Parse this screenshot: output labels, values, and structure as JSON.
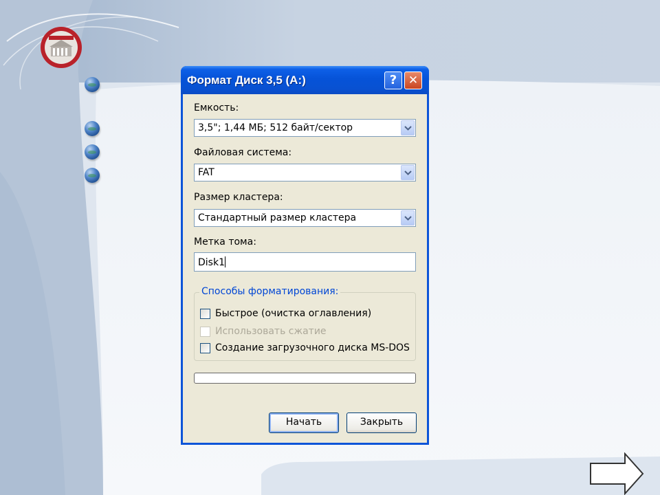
{
  "dialog": {
    "title": "Формат Диск 3,5 (A:)",
    "help_glyph": "?",
    "close_glyph": "✕",
    "capacity": {
      "label": "Емкость:",
      "value": "3,5\";  1,44 МБ; 512 байт/сектор"
    },
    "filesystem": {
      "label": "Файловая система:",
      "value": "FAT"
    },
    "cluster": {
      "label": "Размер кластера:",
      "value": "Стандартный размер кластера"
    },
    "volume": {
      "label": "Метка тома:",
      "value": "Disk1"
    },
    "format_options": {
      "title": "Способы форматирования:",
      "quick": {
        "label": "Быстрое (очистка оглавления)",
        "checked": false
      },
      "compression": {
        "label": "Использовать сжатие",
        "checked": false,
        "enabled": false
      },
      "boot_disk": {
        "label": "Создание загрузочного диска MS-DOS",
        "checked": false
      }
    },
    "progress": 0,
    "start_button": "Начать",
    "close_button": "Закрыть"
  },
  "slide": {
    "bullets": 4,
    "next_icon": "next-arrow-icon",
    "logo_icon": "university-logo-icon"
  },
  "colors": {
    "titlebar": "#0653d8",
    "dialog_face": "#ece9d8",
    "group_title": "#0046d5",
    "slide_bg": "#d7dee8"
  }
}
